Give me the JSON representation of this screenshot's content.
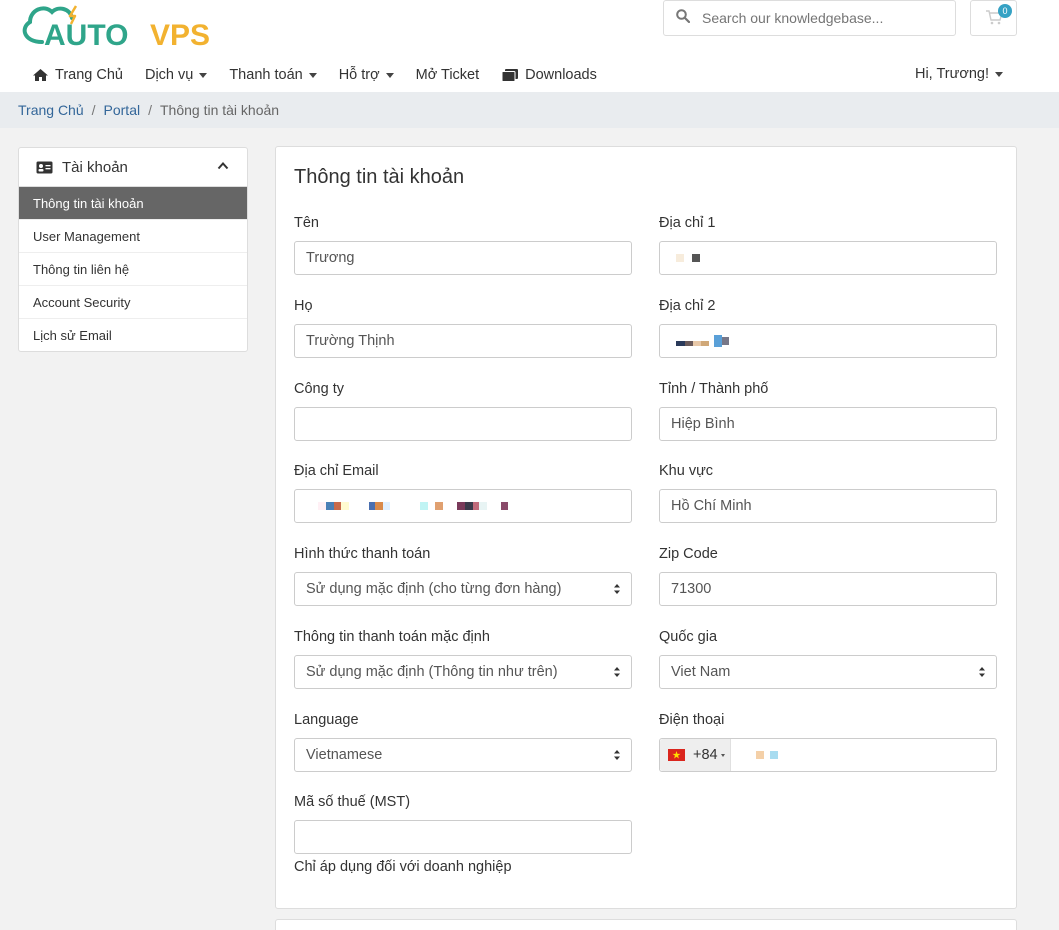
{
  "brand": {
    "logo_auto": "AUTO",
    "logo_vps": "VPS",
    "color_green": "#2fa58a",
    "color_yellow": "#f2b230"
  },
  "search": {
    "placeholder": "Search our knowledgebase...",
    "icon": "search-icon"
  },
  "cart": {
    "count": "0",
    "icon": "cart-icon"
  },
  "nav": {
    "home": "Trang Chủ",
    "services": "Dịch vụ",
    "billing": "Thanh toán",
    "support": "Hỗ trợ",
    "open_ticket": "Mở Ticket",
    "downloads": "Downloads",
    "greeting": "Hi, Trương!"
  },
  "breadcrumb": {
    "home": "Trang Chủ",
    "portal": "Portal",
    "current": "Thông tin tài khoản"
  },
  "sidebar": {
    "title": "Tài khoản",
    "items": [
      {
        "label": "Thông tin tài khoản",
        "active": true
      },
      {
        "label": "User Management"
      },
      {
        "label": "Thông tin liên hệ"
      },
      {
        "label": "Account Security"
      },
      {
        "label": "Lịch sử Email"
      }
    ]
  },
  "form": {
    "title": "Thông tin tài khoản",
    "first_name": {
      "label": "Tên",
      "value": "Trương"
    },
    "last_name": {
      "label": "Họ",
      "value": "Trường Thịnh"
    },
    "company": {
      "label": "Công ty",
      "value": ""
    },
    "email": {
      "label": "Địa chỉ Email",
      "value": ""
    },
    "payment_method": {
      "label": "Hình thức thanh toán",
      "value": "Sử dụng mặc định (cho từng đơn hàng)"
    },
    "billing_contact": {
      "label": "Thông tin thanh toán mặc định",
      "value": "Sử dụng mặc định (Thông tin như trên)"
    },
    "language": {
      "label": "Language",
      "value": "Vietnamese"
    },
    "tax_id": {
      "label": "Mã số thuế (MST)",
      "value": "",
      "help": "Chỉ áp dụng đối với doanh nghiệp"
    },
    "address1": {
      "label": "Địa chỉ 1",
      "value": ""
    },
    "address2": {
      "label": "Địa chỉ 2",
      "value": ""
    },
    "city": {
      "label": "Tỉnh / Thành phố",
      "value": "Hiệp Bình"
    },
    "state": {
      "label": "Khu vực",
      "value": "Hồ Chí Minh"
    },
    "postcode": {
      "label": "Zip Code",
      "value": "71300"
    },
    "country": {
      "label": "Quốc gia",
      "value": "Viet Nam"
    },
    "phone": {
      "label": "Điện thoại",
      "prefix": "+84",
      "value": ""
    }
  }
}
